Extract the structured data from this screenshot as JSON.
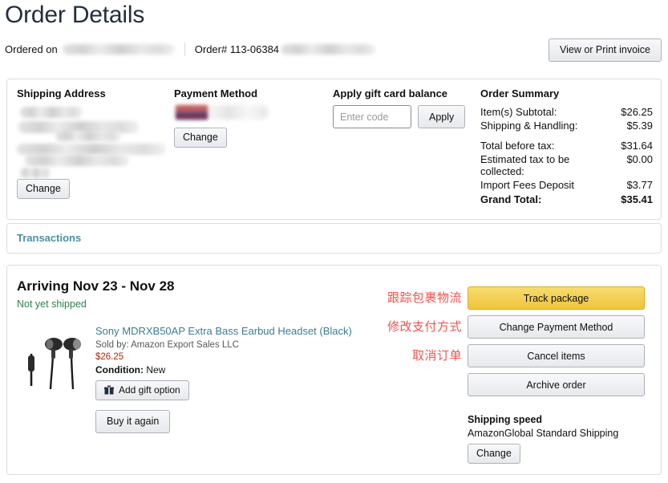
{
  "header": {
    "title": "Order Details",
    "ordered_on_label": "Ordered on",
    "ordered_on_value": "",
    "order_number_label": "Order# 113-06384",
    "invoice_button": "View or Print invoice"
  },
  "summary_card": {
    "shipping_address": {
      "heading": "Shipping Address",
      "lines": [
        "",
        "",
        "",
        "",
        "",
        ""
      ],
      "change_button": "Change"
    },
    "payment_method": {
      "heading": "Payment Method",
      "card_value": "",
      "change_button": "Change"
    },
    "gift_card": {
      "heading": "Apply gift card balance",
      "input_value": "",
      "input_placeholder": "Enter code",
      "apply_button": "Apply"
    },
    "order_summary": {
      "heading": "Order Summary",
      "rows": [
        {
          "label": "Item(s) Subtotal:",
          "value": "$26.25",
          "gap": false,
          "total": false
        },
        {
          "label": "Shipping & Handling:",
          "value": "$5.39",
          "gap": false,
          "total": false
        },
        {
          "label": "Total before tax:",
          "value": "$31.64",
          "gap": true,
          "total": false
        },
        {
          "label": "Estimated tax to be collected:",
          "value": "$0.00",
          "gap": false,
          "total": false
        },
        {
          "label": "Import Fees Deposit",
          "value": "$3.77",
          "gap": false,
          "total": false
        },
        {
          "label": "Grand Total:",
          "value": "$35.41",
          "gap": false,
          "total": true
        }
      ]
    }
  },
  "transactions": {
    "link": "Transactions"
  },
  "shipment": {
    "arriving": "Arriving Nov 23 - Nov 28",
    "status": "Not yet shipped",
    "product": {
      "title": "Sony MDRXB50AP Extra Bass Earbud Headset (Black)",
      "sold_by": "Sold by: Amazon Export Sales LLC",
      "price": "$26.25",
      "condition_label": "Condition:",
      "condition_value": "New",
      "gift_option_button": "Add gift option",
      "buy_again_button": "Buy it again",
      "image_alt": "earbud-headset-thumbnail"
    },
    "actions": [
      {
        "label": "Track package",
        "annotation": "跟踪包裹物流",
        "primary": true
      },
      {
        "label": "Change Payment Method",
        "annotation": "修改支付方式",
        "primary": false
      },
      {
        "label": "Cancel items",
        "annotation": "取消订单",
        "primary": false
      },
      {
        "label": "Archive order",
        "annotation": "",
        "primary": false
      }
    ],
    "shipping_speed": {
      "heading": "Shipping speed",
      "value": "AmazonGlobal Standard Shipping",
      "change_button": "Change"
    }
  },
  "colors": {
    "link": "#3c7d93",
    "price": "#B12704",
    "status_green": "#30804e",
    "annotation_red": "#f4534d",
    "primary_button": "#f0c43c"
  }
}
